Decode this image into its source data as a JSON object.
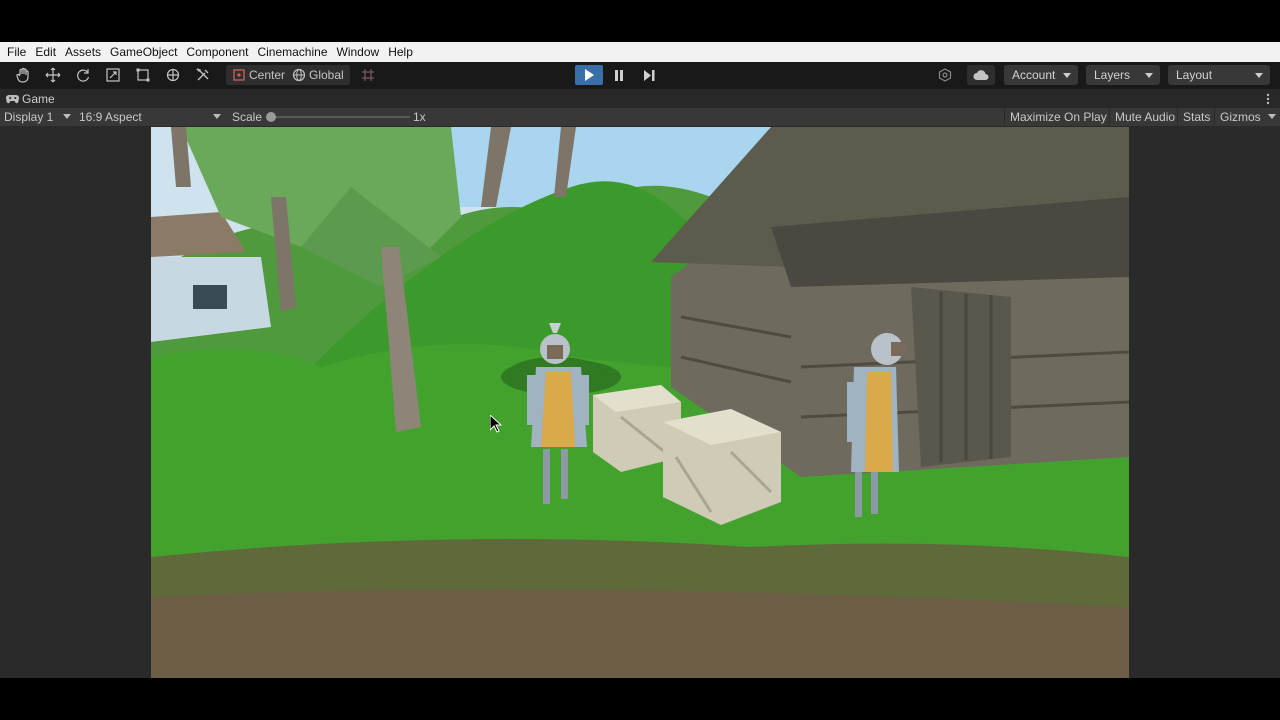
{
  "menu": [
    "File",
    "Edit",
    "Assets",
    "GameObject",
    "Component",
    "Cinemachine",
    "Window",
    "Help"
  ],
  "toolbar": {
    "pivot_label": "Center",
    "space_label": "Global",
    "account_label": "Account",
    "layers_label": "Layers",
    "layout_label": "Layout"
  },
  "tab": {
    "title": "Game"
  },
  "gamebar": {
    "display": "Display 1",
    "aspect": "16:9 Aspect",
    "scale_label": "Scale",
    "scale_value": "1x",
    "maximize": "Maximize On Play",
    "mute": "Mute Audio",
    "stats": "Stats",
    "gizmos": "Gizmos"
  },
  "colors": {
    "play_accent": "#3a6fa8",
    "toolbar_bg": "#191919",
    "panel_bg": "#282828"
  }
}
